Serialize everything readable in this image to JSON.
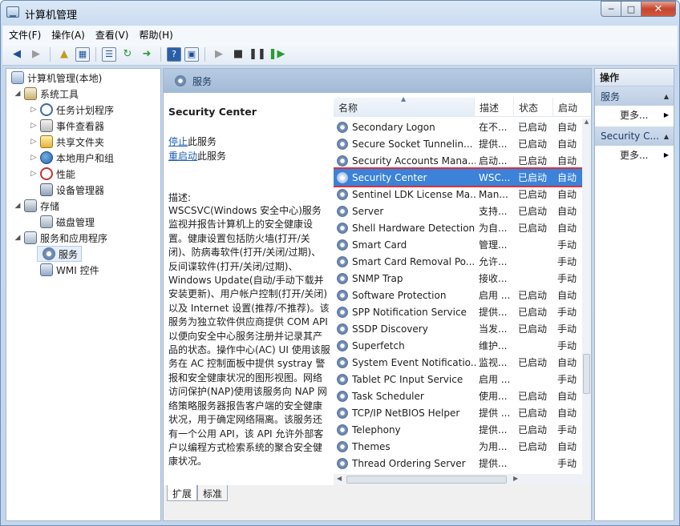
{
  "window": {
    "title": "计算机管理",
    "minimize": "─",
    "maximize": "□",
    "close": "✕"
  },
  "menu": [
    "文件(F)",
    "操作(A)",
    "查看(V)",
    "帮助(H)"
  ],
  "tree": {
    "root": "计算机管理(本地)",
    "system_tools": "系统工具",
    "task_scheduler": "任务计划程序",
    "event_viewer": "事件查看器",
    "shared_folders": "共享文件夹",
    "local_users": "本地用户和组",
    "performance": "性能",
    "device_manager": "设备管理器",
    "storage": "存储",
    "disk_management": "磁盘管理",
    "services_apps": "服务和应用程序",
    "services": "服务",
    "wmi": "WMI 控件"
  },
  "middle": {
    "header": "服务",
    "service_title": "Security Center",
    "stop_link": "停止",
    "stop_suffix": "此服务",
    "restart_link": "重启动",
    "restart_suffix": "此服务",
    "desc_label": "描述:",
    "description": "WSCSVC(Windows 安全中心)服务监视并报告计算机上的安全健康设置。健康设置包括防火墙(打开/关闭)、防病毒软件(打开/关闭/过期)、反间谍软件(打开/关闭/过期)、Windows Update(自动/手动下载并安装更新)、用户帐户控制(打开/关闭)以及 Internet 设置(推荐/不推荐)。该服务为独立软件供应商提供 COM API 以便向安全中心服务注册并记录其产品的状态。操作中心(AC) UI 使用该服务在 AC 控制面板中提供 systray 警报和安全健康状况的图形视图。网络访问保护(NAP)使用该服务向 NAP 网络策略服务器报告客户端的安全健康状况，用于确定网络隔离。该服务还有一个公用 API，该 API 允许外部客户以编程方式检索系统的聚合安全健康状况。",
    "columns": {
      "name": "名称",
      "desc": "描述",
      "status": "状态",
      "startup": "启动"
    },
    "rows": [
      {
        "name": "Secondary Logon",
        "desc": "在不...",
        "status": "已启动",
        "startup": "自动"
      },
      {
        "name": "Secure Socket Tunnelin...",
        "desc": "提供...",
        "status": "已启动",
        "startup": "自动"
      },
      {
        "name": "Security Accounts Mana...",
        "desc": "启动...",
        "status": "已启动",
        "startup": "自动"
      },
      {
        "name": "Security Center",
        "desc": "WSC...",
        "status": "已启动",
        "startup": "自动"
      },
      {
        "name": "Sentinel LDK License Ma...",
        "desc": "Man...",
        "status": "已启动",
        "startup": "自动"
      },
      {
        "name": "Server",
        "desc": "支持...",
        "status": "已启动",
        "startup": "自动"
      },
      {
        "name": "Shell Hardware Detection",
        "desc": "为自...",
        "status": "已启动",
        "startup": "自动"
      },
      {
        "name": "Smart Card",
        "desc": "管理...",
        "status": "",
        "startup": "手动"
      },
      {
        "name": "Smart Card Removal Po...",
        "desc": "允许...",
        "status": "",
        "startup": "手动"
      },
      {
        "name": "SNMP Trap",
        "desc": "接收...",
        "status": "",
        "startup": "手动"
      },
      {
        "name": "Software Protection",
        "desc": "启用 ...",
        "status": "已启动",
        "startup": "自动"
      },
      {
        "name": "SPP Notification Service",
        "desc": "提供...",
        "status": "已启动",
        "startup": "手动"
      },
      {
        "name": "SSDP Discovery",
        "desc": "当发...",
        "status": "已启动",
        "startup": "手动"
      },
      {
        "name": "Superfetch",
        "desc": "维护...",
        "status": "",
        "startup": "手动"
      },
      {
        "name": "System Event Notificatio...",
        "desc": "监视...",
        "status": "已启动",
        "startup": "自动"
      },
      {
        "name": "Tablet PC Input Service",
        "desc": "启用 ...",
        "status": "",
        "startup": "手动"
      },
      {
        "name": "Task Scheduler",
        "desc": "使用...",
        "status": "已启动",
        "startup": "自动"
      },
      {
        "name": "TCP/IP NetBIOS Helper",
        "desc": "提供 ...",
        "status": "已启动",
        "startup": "自动"
      },
      {
        "name": "Telephony",
        "desc": "提供...",
        "status": "已启动",
        "startup": "手动"
      },
      {
        "name": "Themes",
        "desc": "为用...",
        "status": "已启动",
        "startup": "自动"
      },
      {
        "name": "Thread Ordering Server",
        "desc": "提供...",
        "status": "",
        "startup": "手动"
      }
    ],
    "selected_index": 3,
    "tabs": [
      "扩展",
      "标准"
    ]
  },
  "actions": {
    "title": "操作",
    "section1": "服务",
    "more1": "更多...",
    "section2": "Security C...",
    "more2": "更多..."
  }
}
